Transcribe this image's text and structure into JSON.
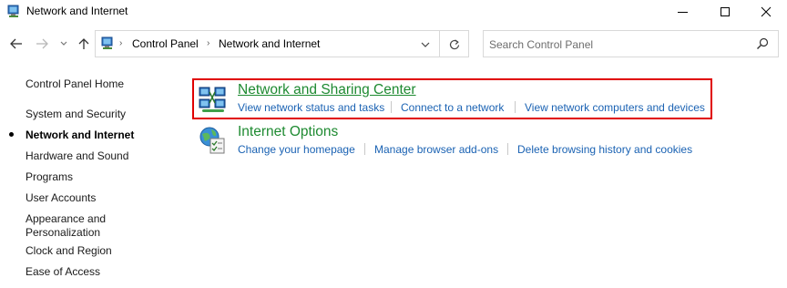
{
  "window": {
    "title": "Network and Internet"
  },
  "address": {
    "crumbs": [
      "Control Panel",
      "Network and Internet"
    ]
  },
  "search": {
    "placeholder": "Search Control Panel"
  },
  "sidebar": {
    "items": [
      {
        "label": "Control Panel Home"
      },
      {
        "label": "System and Security"
      },
      {
        "label": "Network and Internet",
        "active": true
      },
      {
        "label": "Hardware and Sound"
      },
      {
        "label": "Programs"
      },
      {
        "label": "User Accounts"
      },
      {
        "label": "Appearance and"
      },
      {
        "label": "Personalization"
      },
      {
        "label": "Clock and Region"
      },
      {
        "label": "Ease of Access"
      }
    ]
  },
  "categories": [
    {
      "title": "Network and Sharing Center",
      "links": [
        "View network status and tasks",
        "Connect to a network",
        "View network computers and devices"
      ]
    },
    {
      "title": "Internet Options",
      "links": [
        "Change your homepage",
        "Manage browser add-ons",
        "Delete browsing history and cookies"
      ]
    }
  ],
  "colors": {
    "category_title": "#1e8a31",
    "link": "#1a62b3",
    "highlight_border": "#e00000"
  }
}
